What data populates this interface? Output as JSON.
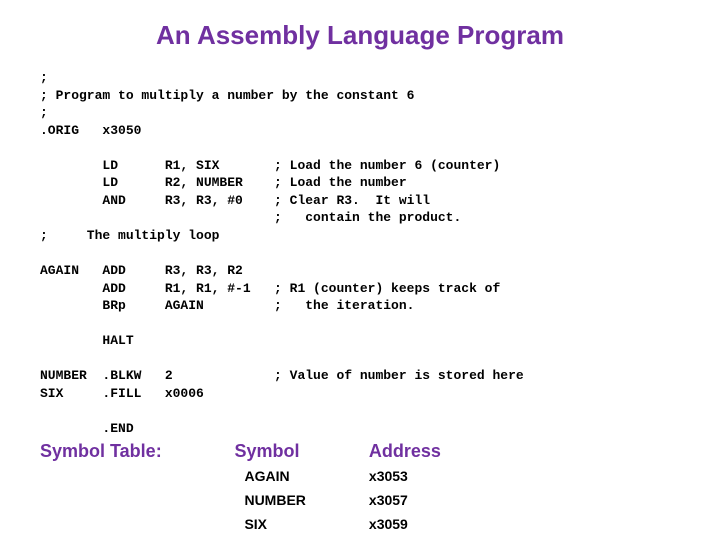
{
  "title": "An Assembly Language Program",
  "code": ";\n; Program to multiply a number by the constant 6\n;\n.ORIG   x3050\n\n        LD      R1, SIX       ; Load the number 6 (counter)\n        LD      R2, NUMBER    ; Load the number\n        AND     R3, R3, #0    ; Clear R3.  It will\n                              ;   contain the product.\n;     The multiply loop\n\nAGAIN   ADD     R3, R3, R2\n        ADD     R1, R1, #-1   ; R1 (counter) keeps track of\n        BRp     AGAIN         ;   the iteration.\n\n        HALT\n\nNUMBER  .BLKW   2             ; Value of number is stored here\nSIX     .FILL   x0006\n\n        .END",
  "symtable": {
    "label": "Symbol Table:",
    "headers": {
      "symbol": "Symbol",
      "address": "Address"
    },
    "rows": [
      {
        "symbol": "AGAIN",
        "address": "x3053"
      },
      {
        "symbol": "NUMBER",
        "address": "x3057"
      },
      {
        "symbol": "SIX",
        "address": "x3059"
      }
    ]
  }
}
